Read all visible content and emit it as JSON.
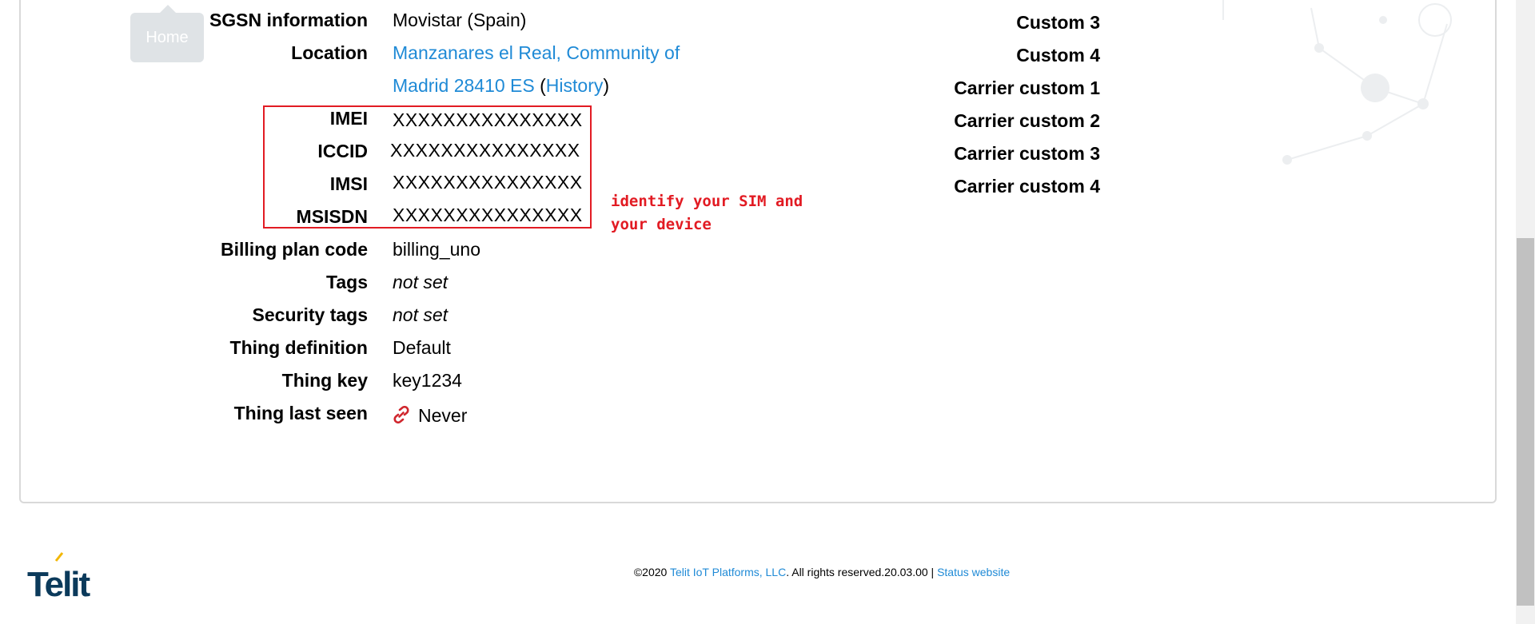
{
  "tooltip": {
    "home": "Home"
  },
  "details": {
    "sgsn": {
      "label": "SGSN information",
      "value": "Movistar (Spain)"
    },
    "location": {
      "label": "Location",
      "line1": "Manzanares el Real, Community of",
      "line2": "Madrid 28410 ES",
      "paren_open": "(",
      "history": "History",
      "paren_close": ")"
    },
    "imei": {
      "label": "IMEI",
      "value": "XXXXXXXXXXXXXXX"
    },
    "iccid": {
      "label": "ICCID",
      "value": "XXXXXXXXXXXXXXX"
    },
    "imsi": {
      "label": "IMSI",
      "value": "XXXXXXXXXXXXXXX"
    },
    "msisdn": {
      "label": "MSISDN",
      "value": "XXXXXXXXXXXXXXX"
    },
    "billing": {
      "label": "Billing plan code",
      "value": "billing_uno"
    },
    "tags": {
      "label": "Tags",
      "value": "not set"
    },
    "security_tags": {
      "label": "Security tags",
      "value": "not set"
    },
    "thing_def": {
      "label": "Thing definition",
      "value": "Default"
    },
    "thing_key": {
      "label": "Thing key",
      "value": "key1234"
    },
    "last_seen": {
      "label": "Thing last seen",
      "value": "Never",
      "icon": "broken-link-icon"
    }
  },
  "annotation": {
    "text": "identify your SIM and your device",
    "color": "#e21b23"
  },
  "custom": {
    "custom3": "Custom 3",
    "custom4": "Custom 4",
    "carrier1": "Carrier custom 1",
    "carrier2": "Carrier custom 2",
    "carrier3": "Carrier custom 3",
    "carrier4": "Carrier custom 4"
  },
  "footer": {
    "copyright": "©2020 ",
    "company_link": "Telit IoT Platforms, LLC",
    "rights": ". All rights reserved.20.03.00 | ",
    "status_link": "Status website"
  },
  "logo": {
    "text": "Telit"
  },
  "colors": {
    "link": "#1f8ad6",
    "highlight": "#e21b23"
  }
}
